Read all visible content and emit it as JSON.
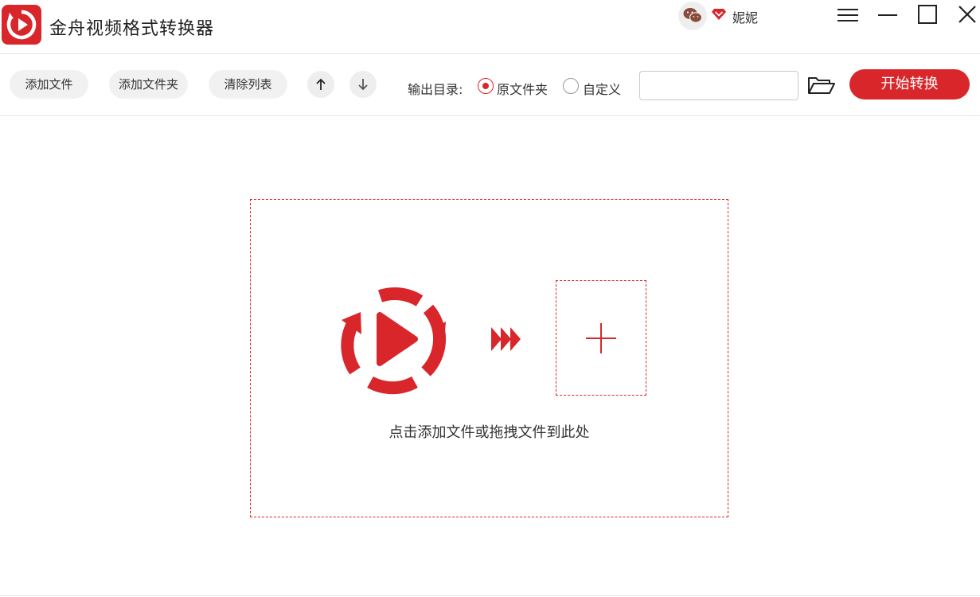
{
  "app": {
    "title": "金舟视频格式转换器",
    "logo_icon": "play-refresh-logo-icon",
    "brand_color": "#d9262b"
  },
  "header": {
    "wechat_icon": "wechat-icon",
    "vip_icon": "vip-diamond-icon",
    "user_name": "妮妮",
    "window_controls": [
      "menu-icon",
      "minimize-icon",
      "maximize-icon",
      "close-icon"
    ]
  },
  "toolbar": {
    "add_file_label": "添加文件",
    "add_folder_label": "添加文件夹",
    "clear_list_label": "清除列表",
    "move_up_icon": "arrow-up-icon",
    "move_down_icon": "arrow-down-icon",
    "output_dir_label": "输出目录:",
    "output_options": [
      {
        "label": "原文件夹",
        "selected": true
      },
      {
        "label": "自定义",
        "selected": false
      }
    ],
    "output_path_value": "",
    "folder_icon": "folder-open-icon",
    "start_label": "开始转换"
  },
  "drop_zone": {
    "hint": "点击添加文件或拖拽文件到此处",
    "logo_icon": "play-refresh-logo-icon",
    "arrows_icon": "fast-forward-icon",
    "add_icon": "plus-icon"
  }
}
